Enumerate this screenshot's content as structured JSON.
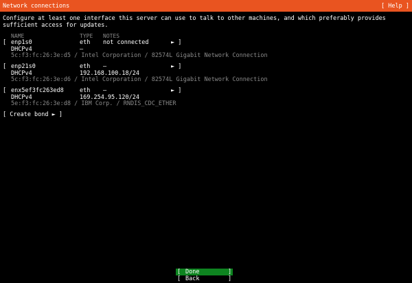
{
  "header": {
    "title": "Network connections",
    "help_label": "[ Help ]"
  },
  "intro": "Configure at least one interface this server can use to talk to other machines, and which preferably provides sufficient access for updates.",
  "columns": {
    "name": "NAME",
    "type": "TYPE",
    "notes": "NOTES"
  },
  "interfaces": [
    {
      "open_bracket": "[",
      "name": "enp1s0",
      "type": "eth",
      "notes": "not connected",
      "arrow": "► ]",
      "mode": "DHCPv4",
      "address": "–",
      "hw": "5c:f3:fc:26:3e:d5 / Intel Corporation / 82574L Gigabit Network Connection"
    },
    {
      "open_bracket": "[",
      "name": "enp21s0",
      "type": "eth",
      "notes": "–",
      "arrow": "► ]",
      "mode": "DHCPv4",
      "address": "192.168.100.18/24",
      "hw": "5c:f3:fc:26:3e:d6 / Intel Corporation / 82574L Gigabit Network Connection"
    },
    {
      "open_bracket": "[",
      "name": "enx5ef3fc263ed8",
      "type": "eth",
      "notes": "–",
      "arrow": "► ]",
      "mode": "DHCPv4",
      "address": "169.254.95.120/24",
      "hw": "5e:f3:fc:26:3e:d8 / IBM Corp. / RNDIS_CDC_ETHER"
    }
  ],
  "create_bond_label": "[ Create bond ► ]",
  "buttons": {
    "done_open": "[",
    "done_label": "Done",
    "done_close": "]",
    "back_open": "[",
    "back_label": "Back",
    "back_close": "]"
  },
  "colors": {
    "header_bg": "#e95420",
    "done_bg": "#0e8420",
    "background": "#000000",
    "dim_text": "#8a8a8a"
  }
}
